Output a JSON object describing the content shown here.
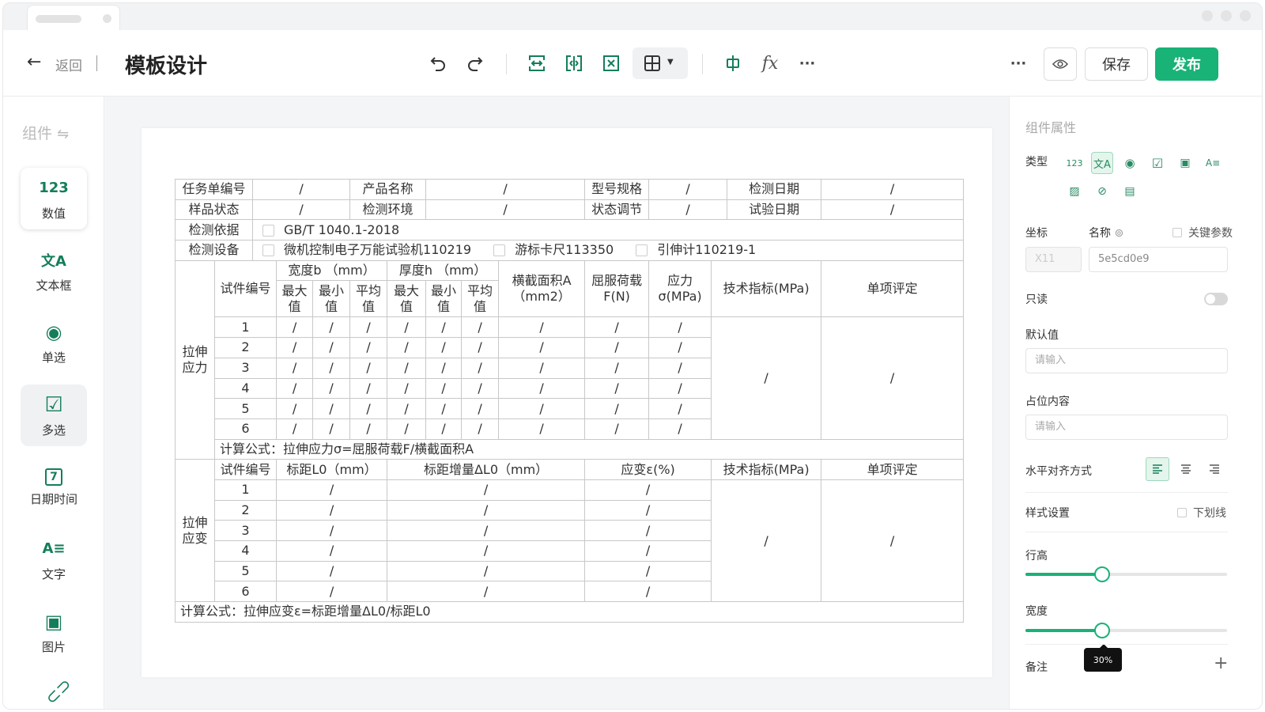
{
  "header": {
    "back_label": "返回",
    "title": "模板设计",
    "save_label": "保存",
    "publish_label": "发布"
  },
  "left_panel": {
    "title": "组件",
    "items": [
      {
        "icon_text": "123",
        "label": "数值"
      },
      {
        "icon_text": "文A",
        "label": "文本框"
      },
      {
        "icon_text": "◉",
        "label": "单选"
      },
      {
        "icon_text": "☑",
        "label": "多选"
      },
      {
        "icon_text": "7",
        "label": "日期时间"
      },
      {
        "icon_text": "A≡",
        "label": "文字"
      },
      {
        "icon_text": "▣",
        "label": "图片"
      }
    ]
  },
  "form": {
    "r1": [
      "任务单编号",
      "/",
      "产品名称",
      "/",
      "型号规格",
      "/",
      "检测日期",
      "/"
    ],
    "r2": [
      "样品状态",
      "/",
      "检测环境",
      "/",
      "状态调节",
      "/",
      "试验日期",
      "/"
    ],
    "basis_label": "检测依据",
    "basis_value": "GB/T 1040.1-2018",
    "equip_label": "检测设备",
    "equip": [
      "微机控制电子万能试验机110219",
      "游标卡尺113350",
      "引伸计110219-1"
    ],
    "stress": {
      "group_label": "拉伸应力",
      "specimen_no": "试件编号",
      "width": "宽度b （mm）",
      "thickness": "厚度h （mm）",
      "max": "最大值",
      "min": "最小值",
      "avg": "平均值",
      "area": "横截面积A（mm2）",
      "yield": "屈服荷载F(N)",
      "stress": "应力σ(MPa)",
      "spec": "技术指标(MPa)",
      "judge": "单项评定",
      "rows": [
        "1",
        "2",
        "3",
        "4",
        "5",
        "6"
      ],
      "slash": "/",
      "formula": "计算公式：拉伸应力σ=屈服荷载F/横截面积A"
    },
    "strain": {
      "group_label": "拉伸应变",
      "specimen_no": "试件编号",
      "gauge": "标距L0（mm）",
      "gauge_inc": "标距增量ΔL0（mm）",
      "strain": "应变ε(%)",
      "spec": "技术指标(MPa)",
      "judge": "单项评定",
      "rows": [
        "1",
        "2",
        "3",
        "4",
        "5",
        "6"
      ],
      "formula": "计算公式：拉伸应变ε=标距增量ΔL0/标距L0"
    }
  },
  "properties": {
    "title": "组件属性",
    "type_label": "类型",
    "type_icons": [
      "number-type-icon",
      "text-type-icon",
      "radio-type-icon",
      "checkbox-type-icon",
      "date-type-icon",
      "label-type-icon",
      "image-type-icon",
      "attachment-type-icon",
      "table-type-icon"
    ],
    "coord_label": "坐标",
    "name_label": "名称",
    "key_param_label": "关键参数",
    "coord_value": "X11",
    "name_value": "5e5cd0e9",
    "readonly_label": "只读",
    "readonly_on": false,
    "default_label": "默认值",
    "default_placeholder": "请输入",
    "placeholder_label": "占位内容",
    "placeholder_placeholder": "请输入",
    "align_label": "水平对齐方式",
    "align_selected": "left",
    "style_label": "样式设置",
    "underline_label": "下划线",
    "row_height_label": "行高",
    "row_height_value": 0.38,
    "width_label": "宽度",
    "width_value": 0.38,
    "width_tooltip": "30%",
    "note_label": "备注"
  },
  "colors": {
    "accent": "#19b277",
    "icon_green": "#147e5a"
  }
}
